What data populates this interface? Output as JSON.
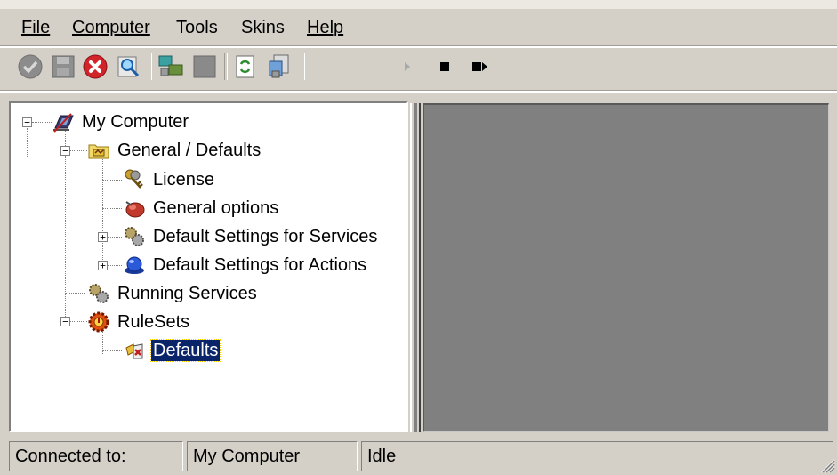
{
  "menu": {
    "file": "File",
    "computer": "Computer",
    "tools": "Tools",
    "skins": "Skins",
    "help": "Help"
  },
  "toolbar": {
    "buttons": [
      "apply-icon",
      "save-icon",
      "delete-icon",
      "find-icon",
      "network-icon",
      "console-icon",
      "refresh-icon",
      "registry-icon",
      "play-icon",
      "stop-icon",
      "step-icon"
    ]
  },
  "tree": {
    "root": "My Computer",
    "general": "General / Defaults",
    "license": "License",
    "general_options": "General options",
    "default_services": "Default Settings for Services",
    "default_actions": "Default Settings for Actions",
    "running_services": "Running Services",
    "rulesets": "RuleSets",
    "defaults": "Defaults"
  },
  "status": {
    "connected_label": "Connected to:",
    "computer": "My Computer",
    "state": "Idle"
  },
  "colors": {
    "window_bg": "#d4d0c8",
    "content_pane": "#808080",
    "selection": "#0a246a"
  }
}
